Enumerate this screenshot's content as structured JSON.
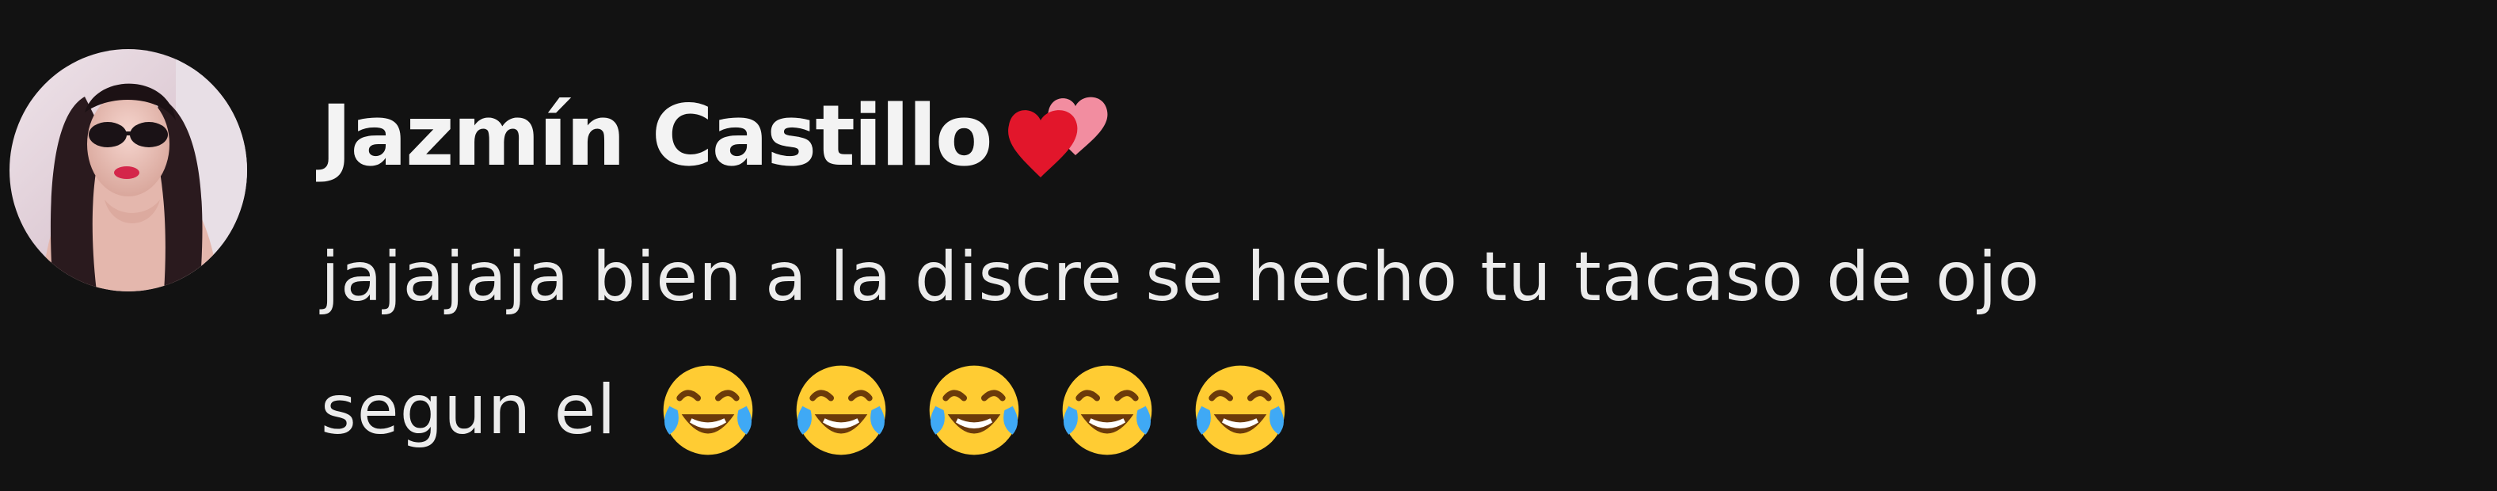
{
  "comment": {
    "author_name": "Jazmín Castillo",
    "author_badge_icon": "two-hearts-icon",
    "avatar_icon": "user-avatar-photo",
    "text_line_1": "jajajaja bien a la discre se hecho tu tacaso de ojo",
    "text_line_2": "segun el",
    "emoji_icon": "face-with-tears-of-joy-icon",
    "emoji_count": 5
  },
  "colors": {
    "background": "#121212",
    "text": "#ececec",
    "heart_red": "#e2162b",
    "heart_pink": "#f28da0",
    "emoji_yellow": "#ffcc33",
    "emoji_tears": "#3fa9f5"
  }
}
